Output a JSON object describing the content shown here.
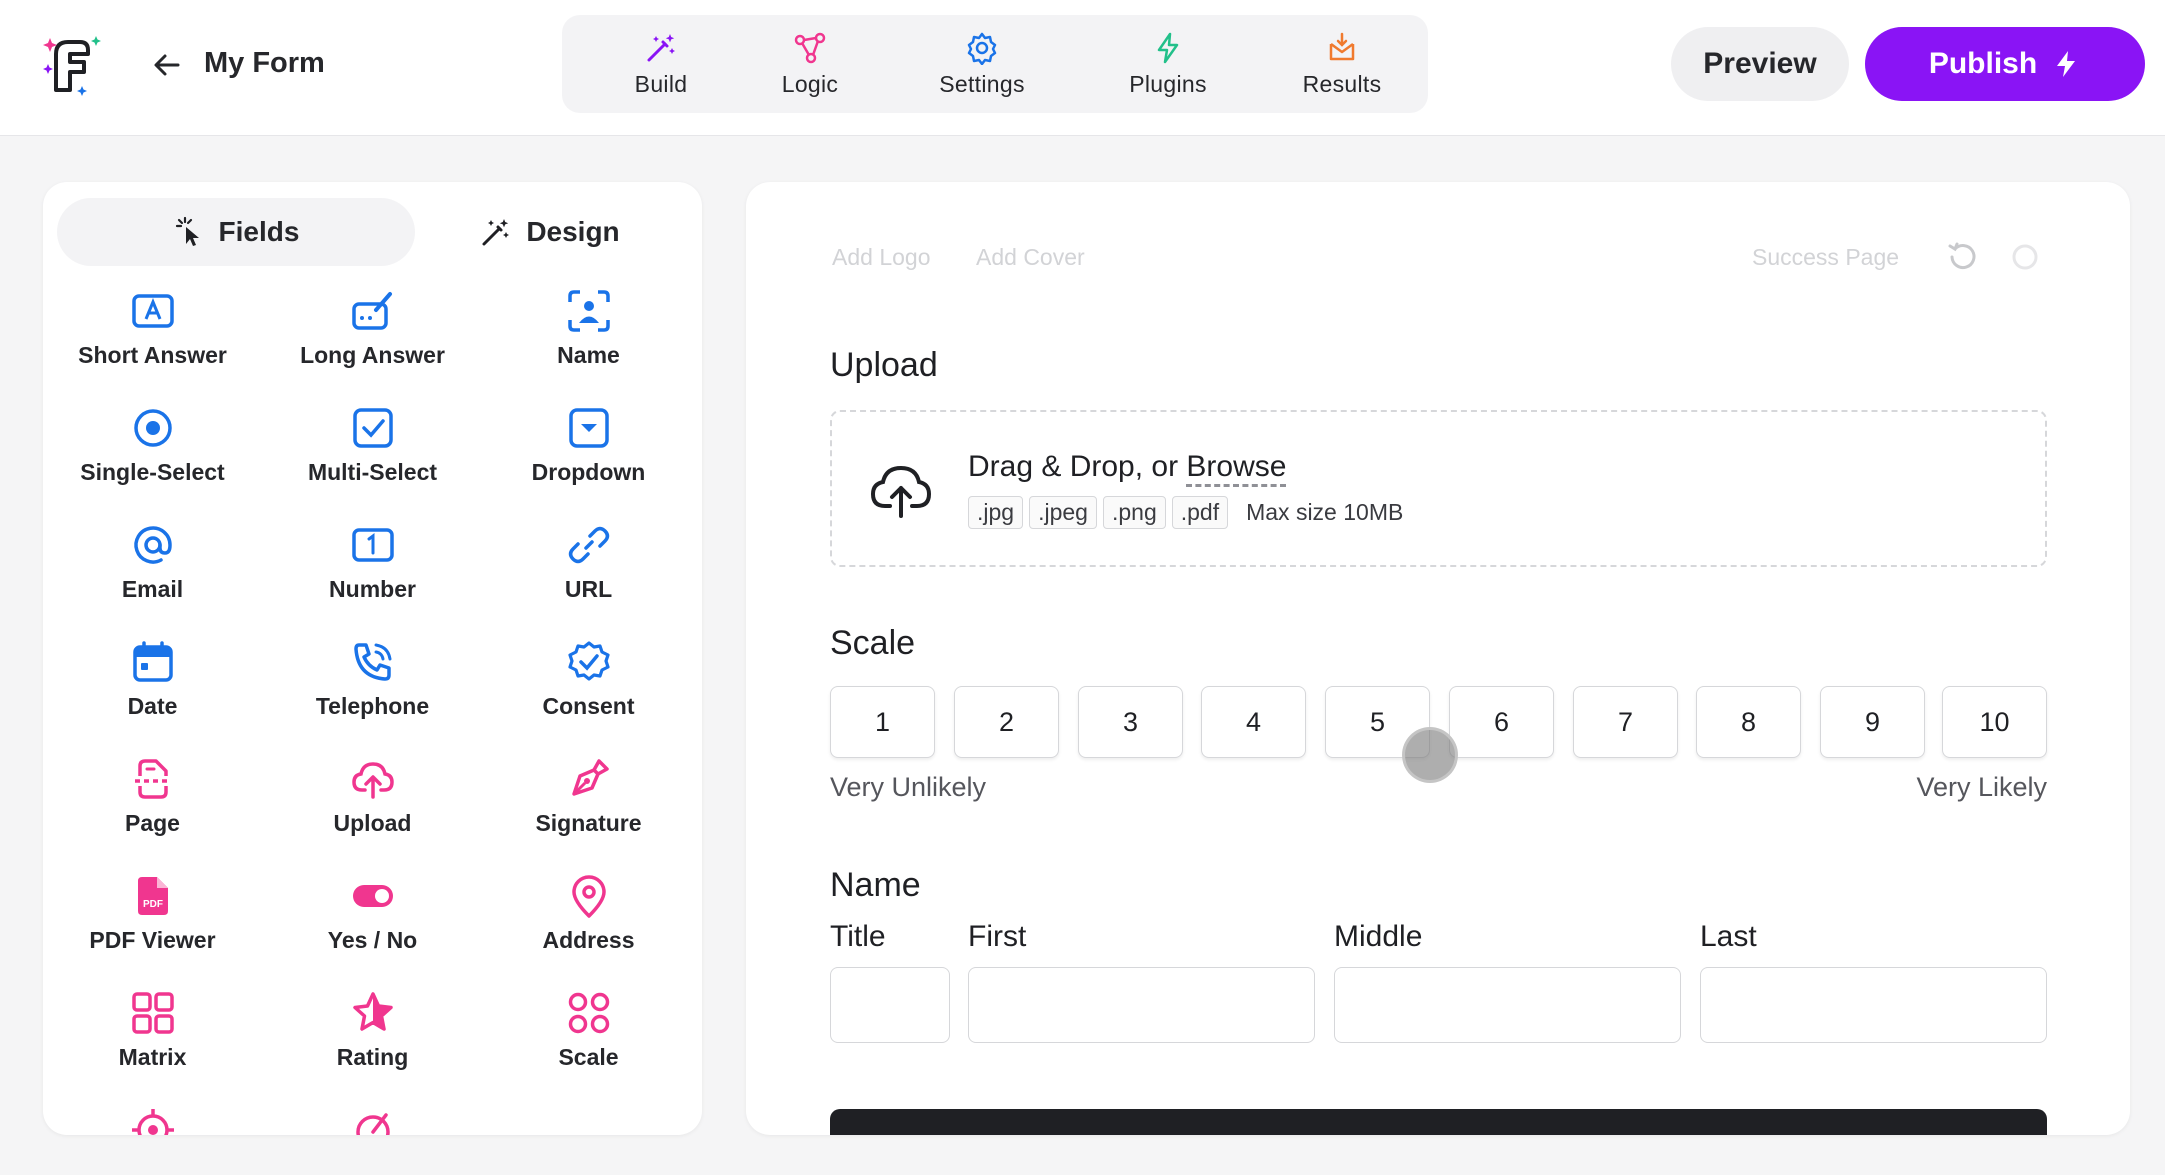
{
  "colors": {
    "accent": "#8a14f5",
    "blue": "#1a73e8",
    "pink": "#f0368f"
  },
  "header": {
    "form_title": "My Form",
    "nav": [
      {
        "label": "Build",
        "icon": "magic-wand-icon"
      },
      {
        "label": "Logic",
        "icon": "logic-nodes-icon"
      },
      {
        "label": "Settings",
        "icon": "gear-icon"
      },
      {
        "label": "Plugins",
        "icon": "lightning-icon"
      },
      {
        "label": "Results",
        "icon": "inbox-icon"
      }
    ],
    "preview_label": "Preview",
    "publish_label": "Publish"
  },
  "sidebar": {
    "tabs": [
      {
        "label": "Fields",
        "icon": "pointer-click-icon"
      },
      {
        "label": "Design",
        "icon": "magic-wand-icon"
      }
    ],
    "fields": [
      {
        "label": "Short Answer",
        "icon": "text-a-icon"
      },
      {
        "label": "Long Answer",
        "icon": "keyboard-pen-icon"
      },
      {
        "label": "Name",
        "icon": "person-scan-icon"
      },
      {
        "label": "Single-Select",
        "icon": "radio-icon"
      },
      {
        "label": "Multi-Select",
        "icon": "checkbox-icon"
      },
      {
        "label": "Dropdown",
        "icon": "dropdown-icon"
      },
      {
        "label": "Email",
        "icon": "at-icon"
      },
      {
        "label": "Number",
        "icon": "number-one-icon"
      },
      {
        "label": "URL",
        "icon": "link-icon"
      },
      {
        "label": "Date",
        "icon": "calendar-icon"
      },
      {
        "label": "Telephone",
        "icon": "phone-icon"
      },
      {
        "label": "Consent",
        "icon": "check-badge-icon"
      },
      {
        "label": "Page",
        "icon": "page-icon"
      },
      {
        "label": "Upload",
        "icon": "cloud-upload-icon"
      },
      {
        "label": "Signature",
        "icon": "pen-nib-icon"
      },
      {
        "label": "PDF Viewer",
        "icon": "pdf-file-icon"
      },
      {
        "label": "Yes / No",
        "icon": "toggle-icon"
      },
      {
        "label": "Address",
        "icon": "map-pin-icon"
      },
      {
        "label": "Matrix",
        "icon": "grid-icon"
      },
      {
        "label": "Rating",
        "icon": "star-icon"
      },
      {
        "label": "Scale",
        "icon": "dots-grid-icon"
      }
    ]
  },
  "canvas": {
    "add_logo": "Add Logo",
    "add_cover": "Add Cover",
    "success_page": "Success Page",
    "upload": {
      "title": "Upload",
      "drop_text": "Drag & Drop, or ",
      "browse": "Browse",
      "extensions": [
        ".jpg",
        ".jpeg",
        ".png",
        ".pdf"
      ],
      "max_size": "Max size 10MB"
    },
    "scale": {
      "title": "Scale",
      "values": [
        "1",
        "2",
        "3",
        "4",
        "5",
        "6",
        "7",
        "8",
        "9",
        "10"
      ],
      "min_label": "Very Unlikely",
      "max_label": "Very Likely"
    },
    "name": {
      "title": "Name",
      "labels": [
        "Title",
        "First",
        "Middle",
        "Last"
      ]
    }
  }
}
